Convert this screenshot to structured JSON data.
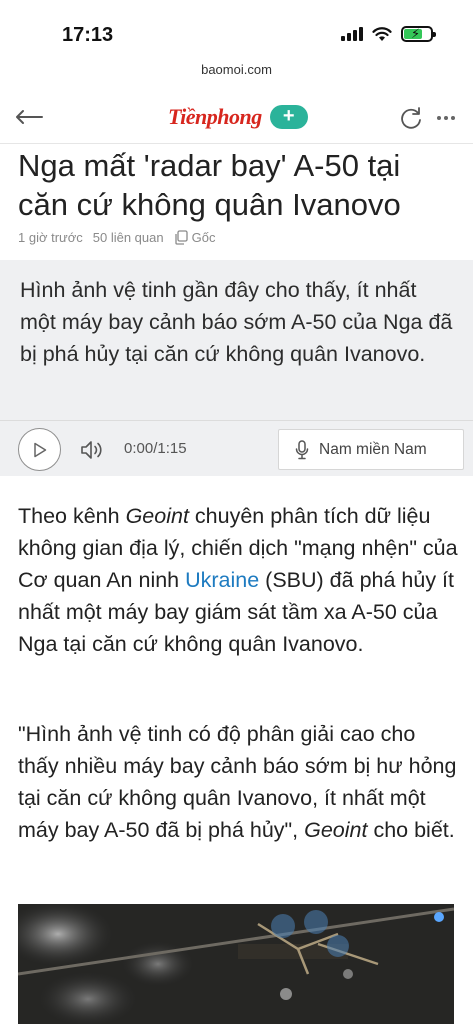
{
  "status_bar": {
    "time": "17:13"
  },
  "browser": {
    "url": "baomoi.com"
  },
  "header": {
    "logo": "Tiềnphong",
    "follow_label": "+"
  },
  "article": {
    "title": "Nga mất 'radar bay' A-50 tại căn cứ không quân Ivanovo",
    "meta": {
      "time_ago": "1 giờ trước",
      "related": "50 liên quan",
      "source": "Gốc"
    },
    "summary": "Hình ảnh vệ tinh gần đây cho thấy, ít nhất một máy bay cảnh báo sớm A-50 của Nga đã bị phá hủy tại căn cứ không quân Ivanovo.",
    "audio": {
      "time": "0:00",
      "duration": "/1:15",
      "voice": "Nam miền Nam"
    },
    "para1": {
      "p1": "Theo kênh ",
      "em1": "Geoint",
      "p2": " chuyên phân tích dữ liệu không gian địa lý, chiến dịch \"mạng nhện\" của Cơ quan An ninh ",
      "link": "Ukraine",
      "p3": " (SBU) đã phá hủy ít nhất một máy bay giám sát tầm xa A-50 của Nga tại căn cứ không quân Ivanovo."
    },
    "para2": {
      "p1": "\"Hình ảnh vệ tinh có độ phân giải cao cho thấy nhiều máy bay cảnh báo sớm bị hư hỏng tại căn cứ không quân Ivanovo, ít nhất một máy bay A-50 đã bị phá hủy\", ",
      "em1": "Geoint",
      "p2": " cho biết."
    }
  },
  "colors": {
    "brand": "#d7261e",
    "accent": "#2bb39a",
    "link": "#1e7bc0",
    "summary_bg": "#eff0f2"
  },
  "icons": [
    "back-arrow-icon",
    "refresh-icon",
    "more-icon",
    "copy-icon",
    "play-icon",
    "speaker-icon",
    "microphone-icon",
    "wifi-icon",
    "battery-icon",
    "signal-icon"
  ]
}
